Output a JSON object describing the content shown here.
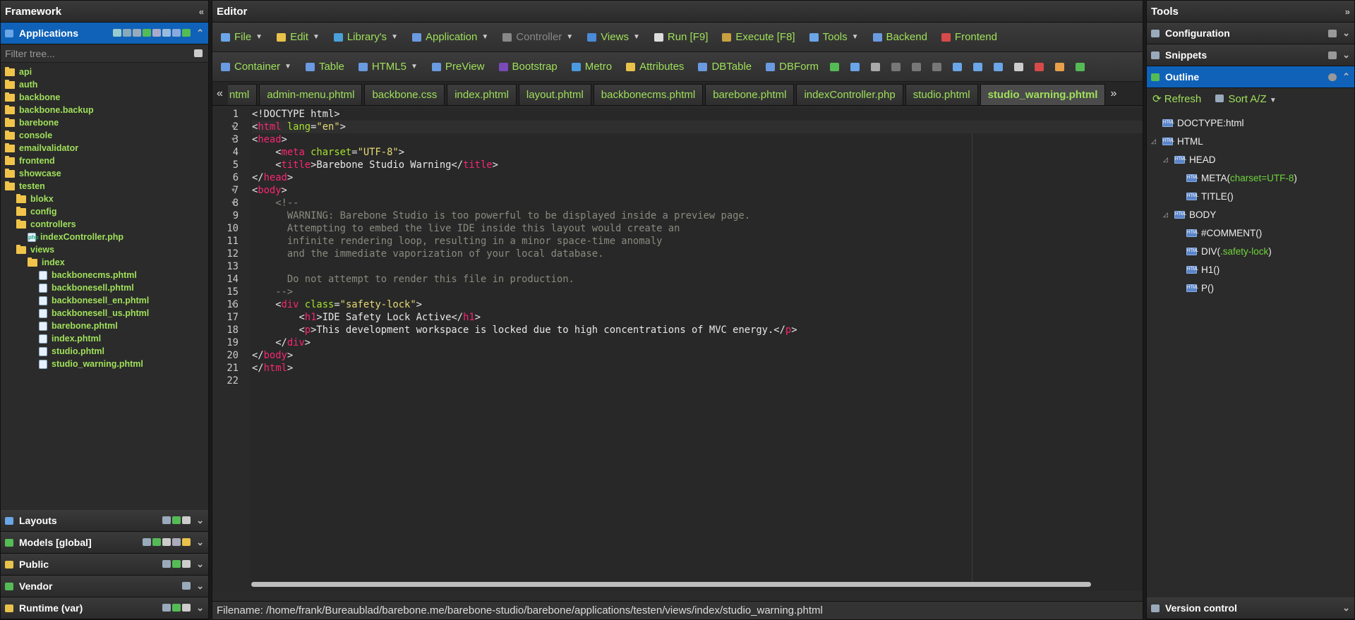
{
  "left": {
    "title": "Framework",
    "applications": "Applications",
    "filter_placeholder": "Filter tree...",
    "tree": [
      {
        "label": "api",
        "indent": 0,
        "icon": "folder"
      },
      {
        "label": "auth",
        "indent": 0,
        "icon": "folder"
      },
      {
        "label": "backbone",
        "indent": 0,
        "icon": "folder"
      },
      {
        "label": "backbone.backup",
        "indent": 0,
        "icon": "folder"
      },
      {
        "label": "barebone",
        "indent": 0,
        "icon": "folder"
      },
      {
        "label": "console",
        "indent": 0,
        "icon": "folder"
      },
      {
        "label": "emailvalidator",
        "indent": 0,
        "icon": "folder"
      },
      {
        "label": "frontend",
        "indent": 0,
        "icon": "folder"
      },
      {
        "label": "showcase",
        "indent": 0,
        "icon": "folder"
      },
      {
        "label": "testen",
        "indent": 0,
        "icon": "folder-open"
      },
      {
        "label": "blokx",
        "indent": 1,
        "icon": "folder"
      },
      {
        "label": "config",
        "indent": 1,
        "icon": "folder"
      },
      {
        "label": "controllers",
        "indent": 1,
        "icon": "folder-open"
      },
      {
        "label": "indexController.php",
        "indent": 2,
        "icon": "php-file"
      },
      {
        "label": "views",
        "indent": 1,
        "icon": "folder-open"
      },
      {
        "label": "index",
        "indent": 2,
        "icon": "folder-open"
      },
      {
        "label": "backbonecms.phtml",
        "indent": 3,
        "icon": "phtml-file"
      },
      {
        "label": "backbonesell.phtml",
        "indent": 3,
        "icon": "phtml-file"
      },
      {
        "label": "backbonesell_en.phtml",
        "indent": 3,
        "icon": "phtml-file"
      },
      {
        "label": "backbonesell_us.phtml",
        "indent": 3,
        "icon": "phtml-file"
      },
      {
        "label": "barebone.phtml",
        "indent": 3,
        "icon": "phtml-file"
      },
      {
        "label": "index.phtml",
        "indent": 3,
        "icon": "phtml-file"
      },
      {
        "label": "studio.phtml",
        "indent": 3,
        "icon": "phtml-file"
      },
      {
        "label": "studio_warning.phtml",
        "indent": 3,
        "icon": "phtml-file"
      }
    ],
    "bottom": [
      "Layouts",
      "Models [global]",
      "Public",
      "Vendor",
      "Runtime (var)"
    ]
  },
  "editor": {
    "title": "Editor",
    "menu1": [
      {
        "label": "File",
        "dd": true,
        "color": "#6aa6e8"
      },
      {
        "label": "Edit",
        "dd": true,
        "color": "#e8c24a"
      },
      {
        "label": "Library's",
        "dd": true,
        "color": "#4aa0d8"
      },
      {
        "label": "Application",
        "dd": true,
        "color": "#6a9ae0"
      },
      {
        "label": "Controller",
        "dd": true,
        "color": "#888888",
        "disabled": true
      },
      {
        "label": "Views",
        "dd": true,
        "color": "#4a8ad8"
      },
      {
        "label": "Run [F9]",
        "dd": false,
        "color": "#dddddd"
      },
      {
        "label": "Execute [F8]",
        "dd": false,
        "color": "#c8a040"
      },
      {
        "label": "Tools",
        "dd": true,
        "color": "#6aa6e8"
      },
      {
        "label": "Backend",
        "dd": false,
        "color": "#6a9ae0"
      },
      {
        "label": "Frontend",
        "dd": false,
        "color": "#d84a4a"
      }
    ],
    "menu2": [
      {
        "label": "Container",
        "dd": true,
        "color": "#6a9ae0"
      },
      {
        "label": "Table",
        "dd": false,
        "color": "#6a9ae0"
      },
      {
        "label": "HTML5",
        "dd": true,
        "color": "#6a9ae0"
      },
      {
        "label": "PreView",
        "dd": false,
        "color": "#6a9ae0"
      },
      {
        "label": "Bootstrap",
        "dd": false,
        "color": "#7a4ab8"
      },
      {
        "label": "Metro",
        "dd": false,
        "color": "#4a9ae0"
      },
      {
        "label": "Attributes",
        "dd": false,
        "color": "#e8c24a"
      },
      {
        "label": "DBTable",
        "dd": false,
        "color": "#6a9ae0"
      },
      {
        "label": "DBForm",
        "dd": false,
        "color": "#6a9ae0"
      }
    ],
    "tabs": [
      "ntml",
      "admin-menu.phtml",
      "backbone.css",
      "index.phtml",
      "layout.phtml",
      "backbonecms.phtml",
      "barebone.phtml",
      "indexController.php",
      "studio.phtml",
      "studio_warning.phtml"
    ],
    "active_tab": "studio_warning.phtml",
    "code": [
      "<!DOCTYPE html>",
      "<html lang=\"en\">",
      "<head>",
      "    <meta charset=\"UTF-8\">",
      "    <title>Barebone Studio Warning</title>",
      "</head>",
      "<body>",
      "    <!--",
      "      WARNING: Barebone Studio is too powerful to be displayed inside a preview page.",
      "      Attempting to embed the live IDE inside this layout would create an",
      "      infinite rendering loop, resulting in a minor space-time anomaly",
      "      and the immediate vaporization of your local database.",
      "",
      "      Do not attempt to render this file in production.",
      "    -->",
      "    <div class=\"safety-lock\">",
      "        <h1>IDE Safety Lock Active</h1>",
      "        <p>This development workspace is locked due to high concentrations of MVC energy.</p>",
      "    </div>",
      "</body>",
      "</html>",
      ""
    ],
    "folds": [
      2,
      3,
      7,
      8,
      16
    ],
    "status": "Filename: /home/frank/Bureaublad/barebone.me/barebone-studio/barebone/applications/testen/views/index/studio_warning.phtml"
  },
  "right": {
    "title": "Tools",
    "sections": [
      "Configuration",
      "Snippets",
      "Outline"
    ],
    "refresh": "Refresh",
    "sort": "Sort A/Z",
    "outline": [
      {
        "tag": "DOCTYPE:html",
        "attr": "",
        "indent": 0,
        "tri": false
      },
      {
        "tag": "HTML",
        "attr": "",
        "indent": 0,
        "tri": true
      },
      {
        "tag": "HEAD",
        "attr": "",
        "indent": 1,
        "tri": true
      },
      {
        "tag": "META(",
        "attr": "charset=UTF-8",
        "close": ")",
        "indent": 2,
        "tri": false
      },
      {
        "tag": "TITLE()",
        "attr": "",
        "indent": 2,
        "tri": false
      },
      {
        "tag": "BODY",
        "attr": "",
        "indent": 1,
        "tri": true
      },
      {
        "tag": "#COMMENT()",
        "attr": "",
        "indent": 2,
        "tri": false
      },
      {
        "tag": "DIV(",
        "attr": ".safety-lock",
        "close": ")",
        "indent": 2,
        "tri": false
      },
      {
        "tag": "H1()",
        "attr": "",
        "indent": 2,
        "tri": false
      },
      {
        "tag": "P()",
        "attr": "",
        "indent": 2,
        "tri": false
      }
    ],
    "version": "Version control"
  }
}
